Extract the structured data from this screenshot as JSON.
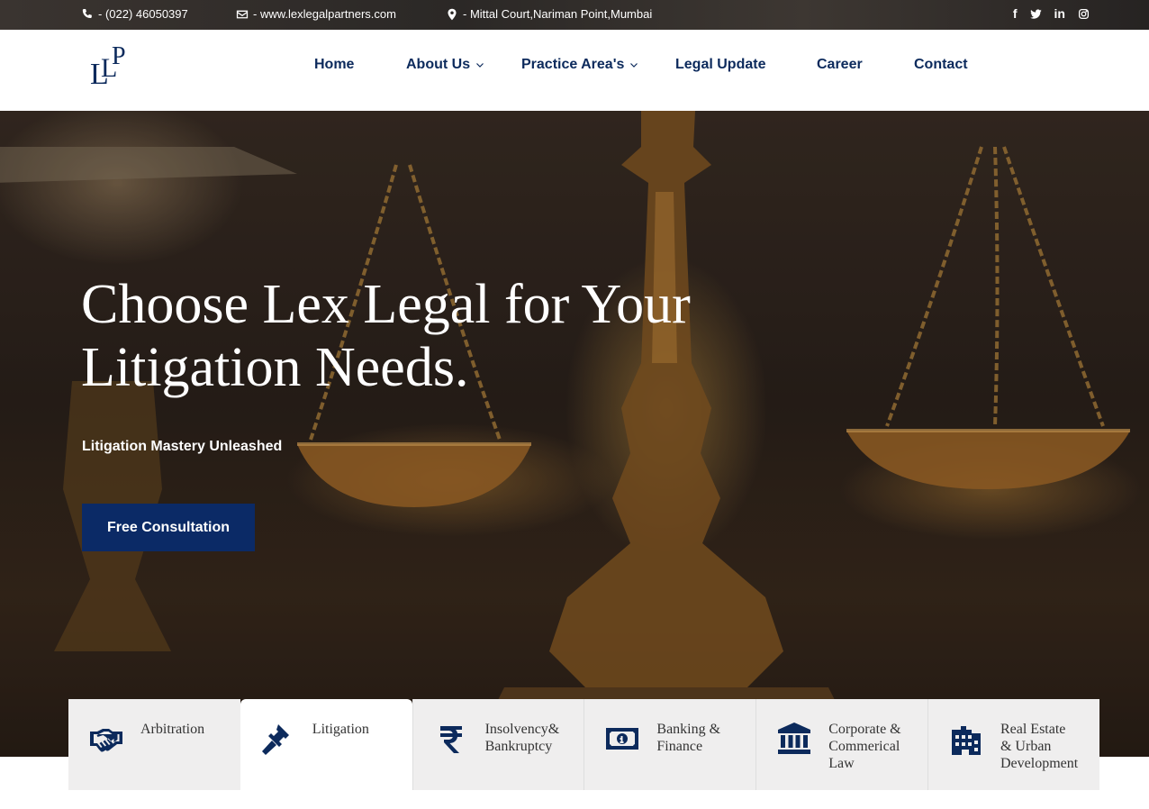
{
  "topbar": {
    "phone": "- (022) 46050397",
    "email": "- www.lexlegalpartners.com",
    "location": "- Mittal Court,Nariman Point,Mumbai",
    "social": {
      "facebook": "f",
      "linkedin": "in"
    }
  },
  "nav": {
    "logo_text": "LLP",
    "items": [
      {
        "label": "Home"
      },
      {
        "label": "About Us"
      },
      {
        "label": "Practice Area's"
      },
      {
        "label": "Legal Update"
      },
      {
        "label": "Career"
      },
      {
        "label": "Contact"
      }
    ]
  },
  "hero": {
    "title": "Choose Lex Legal for Your Litigation Needs.",
    "subtitle": "Litigation Mastery Unleashed",
    "cta": "Free Consultation"
  },
  "practice_tabs": [
    {
      "label": "Arbitration",
      "icon": "handshake-icon"
    },
    {
      "label": "Litigation",
      "icon": "gavel-icon"
    },
    {
      "label": "Insolvency&\nBankruptcy",
      "icon": "rupee-icon"
    },
    {
      "label": "Banking &\nFinance",
      "icon": "money-bill-icon"
    },
    {
      "label": "Corporate &\nCommerical\nLaw",
      "icon": "bank-building-icon"
    },
    {
      "label": "Real Estate\n& Urban\nDevelopment",
      "icon": "city-buildings-icon"
    }
  ],
  "colors": {
    "brand_navy": "#0b2a66",
    "nav_text": "#0c2a5c",
    "tab_bg": "#efeeee"
  }
}
